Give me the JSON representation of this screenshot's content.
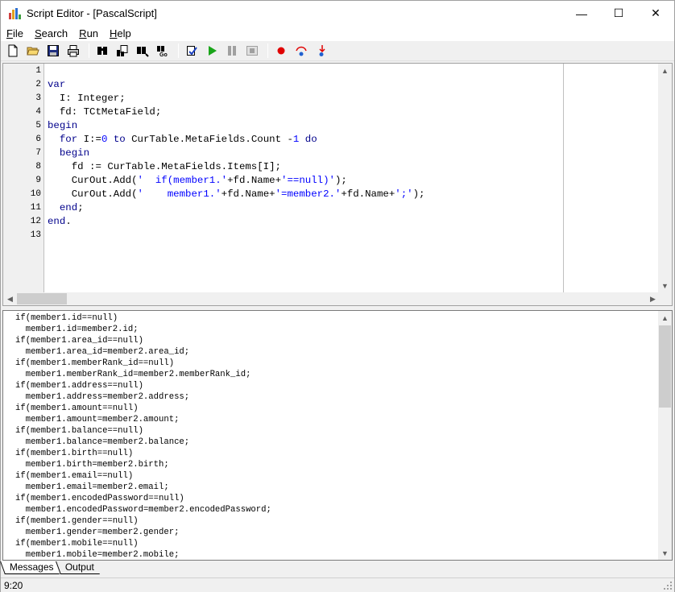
{
  "window": {
    "title": "Script Editor - [PascalScript]",
    "min_glyph": "—",
    "max_glyph": "☐",
    "close_glyph": "✕"
  },
  "menu": [
    {
      "label": "File",
      "accel": "F",
      "rest": "ile"
    },
    {
      "label": "Search",
      "accel": "S",
      "rest": "earch"
    },
    {
      "label": "Run",
      "accel": "R",
      "rest": "un"
    },
    {
      "label": "Help",
      "accel": "H",
      "rest": "elp"
    }
  ],
  "toolbar": [
    {
      "icon": "new-file-icon"
    },
    {
      "icon": "open-folder-icon"
    },
    {
      "icon": "save-icon"
    },
    {
      "icon": "print-icon"
    },
    {
      "sep": true
    },
    {
      "icon": "find-icon"
    },
    {
      "icon": "replace-icon"
    },
    {
      "icon": "find-next-icon"
    },
    {
      "icon": "goto-line-icon"
    },
    {
      "sep": true
    },
    {
      "icon": "syntax-check-icon"
    },
    {
      "icon": "run-icon",
      "color": "#1aa51a"
    },
    {
      "icon": "pause-icon"
    },
    {
      "icon": "stop-icon"
    },
    {
      "sep": true
    },
    {
      "icon": "breakpoint-icon",
      "color": "#e00000"
    },
    {
      "icon": "step-over-icon"
    },
    {
      "icon": "step-into-icon"
    }
  ],
  "editor": {
    "line_numbers": [
      "1",
      "2",
      "3",
      "4",
      "5",
      "6",
      "7",
      "8",
      "9",
      "10",
      "11",
      "12",
      "13"
    ],
    "lines": [
      [],
      [
        {
          "t": "var",
          "c": "kw"
        }
      ],
      [
        {
          "t": "  I: Integer;",
          "c": ""
        }
      ],
      [
        {
          "t": "  fd: TCtMetaField;",
          "c": ""
        }
      ],
      [
        {
          "t": "begin",
          "c": "kw"
        }
      ],
      [
        {
          "t": "  ",
          "c": ""
        },
        {
          "t": "for",
          "c": "kw"
        },
        {
          "t": " I:=",
          "c": ""
        },
        {
          "t": "0",
          "c": "num"
        },
        {
          "t": " ",
          "c": ""
        },
        {
          "t": "to",
          "c": "kw"
        },
        {
          "t": " CurTable.MetaFields.Count -",
          "c": ""
        },
        {
          "t": "1",
          "c": "num"
        },
        {
          "t": " ",
          "c": ""
        },
        {
          "t": "do",
          "c": "kw"
        }
      ],
      [
        {
          "t": "  ",
          "c": ""
        },
        {
          "t": "begin",
          "c": "kw"
        }
      ],
      [
        {
          "t": "    fd := CurTable.MetaFields.Items[I];",
          "c": ""
        }
      ],
      [
        {
          "t": "    CurOut.Add(",
          "c": ""
        },
        {
          "t": "'  if(member1.'",
          "c": "str"
        },
        {
          "t": "+fd.Name+",
          "c": ""
        },
        {
          "t": "'==null)'",
          "c": "str"
        },
        {
          "t": ");",
          "c": ""
        }
      ],
      [
        {
          "t": "    CurOut.Add(",
          "c": ""
        },
        {
          "t": "'    member1.'",
          "c": "str"
        },
        {
          "t": "+fd.Name+",
          "c": ""
        },
        {
          "t": "'=member2.'",
          "c": "str"
        },
        {
          "t": "+fd.Name+",
          "c": ""
        },
        {
          "t": "';'",
          "c": "str"
        },
        {
          "t": ");",
          "c": ""
        }
      ],
      [
        {
          "t": "  ",
          "c": ""
        },
        {
          "t": "end",
          "c": "kw"
        },
        {
          "t": ";",
          "c": ""
        }
      ],
      [
        {
          "t": "end",
          "c": "kw"
        },
        {
          "t": ".",
          "c": ""
        }
      ],
      []
    ]
  },
  "output": {
    "lines": [
      "if(member1.id==null)",
      "  member1.id=member2.id;",
      "if(member1.area_id==null)",
      "  member1.area_id=member2.area_id;",
      "if(member1.memberRank_id==null)",
      "  member1.memberRank_id=member2.memberRank_id;",
      "if(member1.address==null)",
      "  member1.address=member2.address;",
      "if(member1.amount==null)",
      "  member1.amount=member2.amount;",
      "if(member1.balance==null)",
      "  member1.balance=member2.balance;",
      "if(member1.birth==null)",
      "  member1.birth=member2.birth;",
      "if(member1.email==null)",
      "  member1.email=member2.email;",
      "if(member1.encodedPassword==null)",
      "  member1.encodedPassword=member2.encodedPassword;",
      "if(member1.gender==null)",
      "  member1.gender=member2.gender;",
      "if(member1.mobile==null)",
      "  member1.mobile=member2.mobile;"
    ]
  },
  "tabs": [
    {
      "label": "Messages",
      "active": true
    },
    {
      "label": "Output",
      "active": false
    }
  ],
  "status": {
    "cursor": "9:20"
  }
}
